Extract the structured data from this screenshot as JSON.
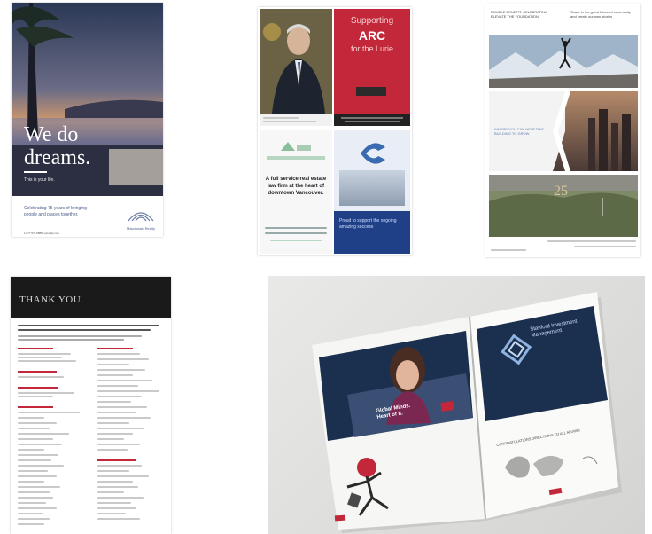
{
  "ad1": {
    "headline": "We do dreams.",
    "sub": "This is your life.",
    "body": "Celebrating 75 years of bringing people and places together.",
    "contact": "1.877.575.8888 | cjrrealty.com",
    "brand": "Macdonald Realty"
  },
  "ad2": {
    "top_right_title_1": "Supporting",
    "top_right_title_2": "ARC",
    "top_right_title_3": "for the Lurie",
    "bottom_left_text": "A full service real estate law firm at the heart of downtown Vancouver.",
    "bottom_right_text": "Proud to support the ongoing amazing success"
  },
  "ad3": {
    "header_left": "DOUBLE BENEFIT. CELEBRATING ELEVATE THE FOUNDATION",
    "header_right": "Share in the great future of community and create our own stories",
    "mid_text": "WHERE YOU CAN HELP THIS BUILDING TO GROW",
    "badge": "25"
  },
  "thankyou": {
    "title": "THANK YOU"
  },
  "brochure": {
    "left_headline": "Global Minds. Heart of It.",
    "right_title": "Stanford Investment Management",
    "right_sub": "CONGRATULATIONS DIRECTIONS TO ALL ALUMNI"
  },
  "colors": {
    "dusk_sky": "#2e3a55",
    "red_ad": "#c2273a",
    "dark_navy": "#1b2f4e",
    "thank_header": "#1a1a1a"
  }
}
